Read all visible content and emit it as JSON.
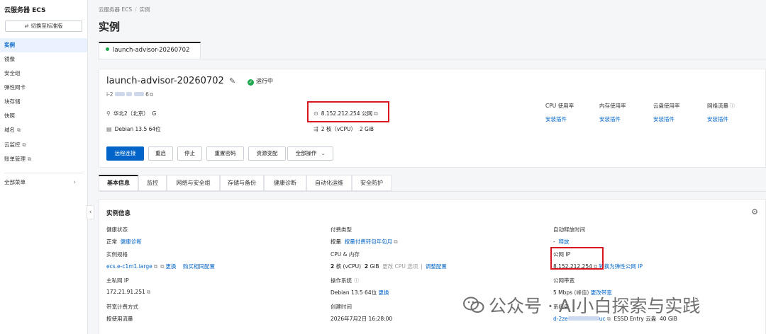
{
  "sidebar": {
    "title": "云服务器 ECS",
    "switch_label": "切换至标准版",
    "items": [
      {
        "label": "实例"
      },
      {
        "label": "镜像"
      },
      {
        "label": "安全组"
      },
      {
        "label": "弹性网卡"
      },
      {
        "label": "块存储"
      },
      {
        "label": "快照"
      },
      {
        "label": "域名"
      },
      {
        "label": "云监控"
      },
      {
        "label": "账单管理"
      }
    ],
    "all_menu": "全部菜单"
  },
  "breadcrumb": {
    "root": "云服务器 ECS",
    "sep": "/",
    "current": "实例"
  },
  "page_title": "实例",
  "instance_tab": "launch-advisor-20260702",
  "summary": {
    "name": "launch-advisor-20260702",
    "status": "运行中",
    "id_prefix": "i-2",
    "id_suffix": "6",
    "region": "华北2（北京）",
    "zone": "G",
    "os": "Debian 13.5 64位",
    "public_ip": "8.152.212.254",
    "public_ip_suffix": "公网",
    "cpu": "2 核（vCPU）",
    "mem": "2 GiB",
    "metrics": [
      {
        "label": "CPU 使用率",
        "link": "安装插件"
      },
      {
        "label": "内存使用率",
        "link": "安装插件"
      },
      {
        "label": "云盘使用率",
        "link": "安装插件"
      },
      {
        "label": "网络流量",
        "link": "安装插件"
      }
    ],
    "buttons": {
      "remote": "远程连接",
      "restart": "重启",
      "stop": "停止",
      "reset_pwd": "重置密码",
      "resize": "资源变配",
      "all_ops": "全部操作"
    }
  },
  "detail_tabs": [
    "基本信息",
    "监控",
    "网络与安全组",
    "存储与备份",
    "健康诊断",
    "自动化运维",
    "安全防护"
  ],
  "instance_info": {
    "title": "实例信息",
    "health": {
      "label": "健康状态",
      "value": "正常",
      "link": "健康诊断"
    },
    "billing": {
      "label": "付费类型",
      "value": "按量",
      "link": "按量付费转包年包月"
    },
    "auto_release": {
      "label": "自动释放时间",
      "value": "-",
      "link": "释放"
    },
    "spec": {
      "label": "实例规格",
      "value": "ecs.e-c1m1.large",
      "link1": "更换",
      "link2": "购买相同配置"
    },
    "cpu_mem": {
      "label": "CPU & 内存",
      "cpu_num": "2",
      "cpu_unit": "核 (vCPU)",
      "mem_num": "2",
      "mem_unit": "GiB",
      "muted": "更改 CPU 选项",
      "link": "调整配置"
    },
    "public_ip": {
      "label": "公网 IP",
      "value": "8.152.212.254",
      "link": "转换为弹性公网 IP"
    },
    "private_ip": {
      "label": "主私网 IP",
      "value": "172.21.91.251"
    },
    "os": {
      "label": "操作系统",
      "value": "Debian 13.5 64位",
      "link": "更换"
    },
    "bandwidth": {
      "label": "公网带宽",
      "value": "5 Mbps",
      "peak": "(峰值)",
      "link": "更改带宽"
    },
    "bw_billing": {
      "label": "带宽计费方式",
      "value": "按使用流量"
    },
    "created": {
      "label": "创建时间",
      "value": "2026年7月2日 16:28:00"
    },
    "disk": {
      "label": "系统盘",
      "prefix": "d-2ze",
      "suffix": "uc",
      "type": "ESSD Entry 云盘",
      "size": "40 GiB"
    }
  },
  "watermark": "公众号 · AI小白探索与实践",
  "colors": {
    "accent": "#0064c8",
    "running": "#1fa750",
    "highlight": "#d7191f"
  }
}
